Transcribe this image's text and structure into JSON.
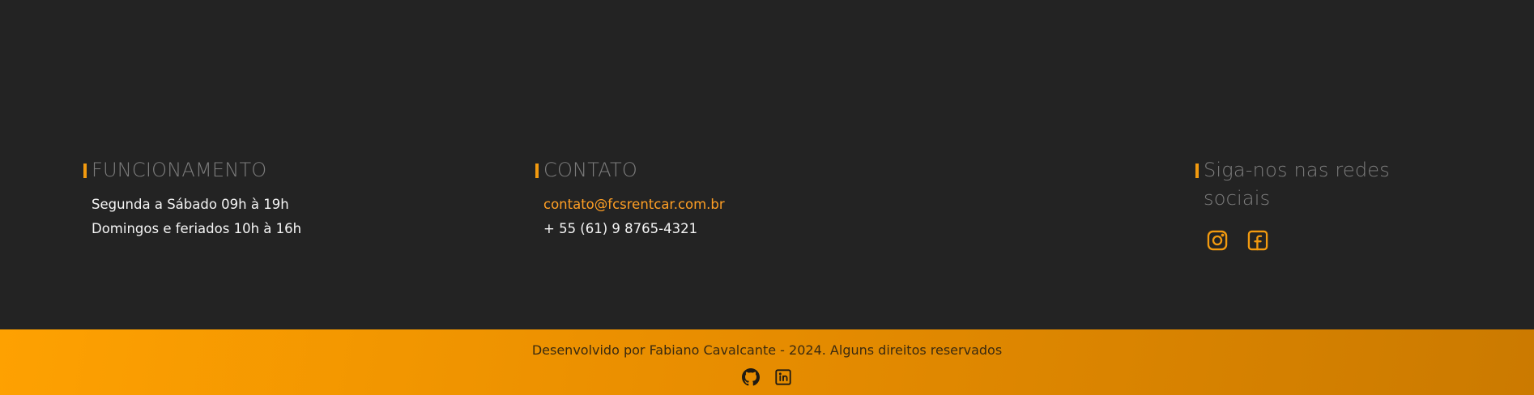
{
  "hours": {
    "heading": "FUNCIONAMENTO",
    "lines": [
      "Segunda a Sábado 09h à 19h",
      "Domingos e feriados 10h à 16h"
    ]
  },
  "contact": {
    "heading": "CONTATO",
    "email": "contato@fcsrentcar.com.br",
    "phone": "+ 55 (61) 9 8765-4321"
  },
  "social": {
    "heading": "Siga-nos nas redes sociais",
    "icons": [
      "instagram-icon",
      "facebook-icon"
    ]
  },
  "footer_bar": {
    "copyright": "Desenvolvido por Fabiano Cavalcante - 2024. Alguns direitos reservados",
    "icons": [
      "github-icon",
      "linkedin-icon"
    ]
  },
  "colors": {
    "background": "#232323",
    "accent": "#f29a0f",
    "link": "#ff9f24",
    "heading": "#7d7d7d",
    "bar_gradient_start": "#fea101",
    "bar_gradient_end": "#cb7a00"
  }
}
